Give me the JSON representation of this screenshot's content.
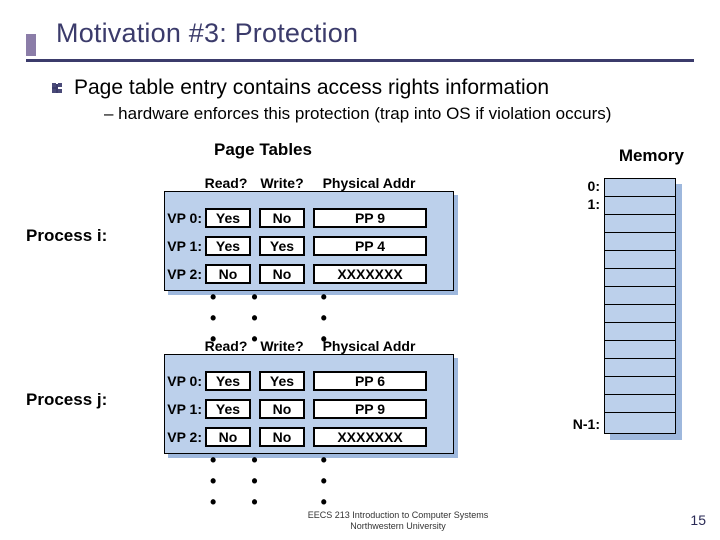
{
  "title": "Motivation #3: Protection",
  "b1": "Page table entry contains access rights information",
  "b2": "– hardware enforces this protection (trap into OS if violation occurs)",
  "ptlabel": "Page Tables",
  "memlabel": "Memory",
  "proc_i": "Process i:",
  "proc_j": "Process j:",
  "hdr": {
    "r": "Read?",
    "w": "Write?",
    "p": "Physical Addr"
  },
  "ti": {
    "r0": {
      "vp": "VP 0:",
      "r": "Yes",
      "w": "No",
      "p": "PP 9"
    },
    "r1": {
      "vp": "VP 1:",
      "r": "Yes",
      "w": "Yes",
      "p": "PP 4"
    },
    "r2": {
      "vp": "VP 2:",
      "r": "No",
      "w": "No",
      "p": "XXXXXXX"
    }
  },
  "tj": {
    "r0": {
      "vp": "VP 0:",
      "r": "Yes",
      "w": "Yes",
      "p": "PP 6"
    },
    "r1": {
      "vp": "VP 1:",
      "r": "Yes",
      "w": "No",
      "p": "PP 9"
    },
    "r2": {
      "vp": "VP 2:",
      "r": "No",
      "w": "No",
      "p": "XXXXXXX"
    }
  },
  "mem": {
    "r0": "0:",
    "r1": "1:",
    "rn": "N-1:"
  },
  "footer1": "EECS 213 Introduction to Computer Systems",
  "footer2": "Northwestern University",
  "pagenum": "15"
}
